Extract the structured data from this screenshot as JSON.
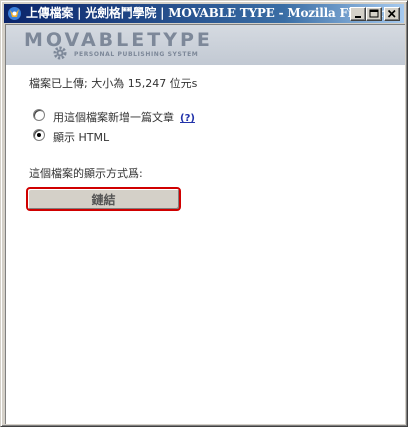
{
  "window": {
    "title": "上傳檔案 | 光劍格鬥學院 | MOVABLE TYPE - Mozilla Firebird",
    "controls": [
      "minimize",
      "maximize",
      "close"
    ]
  },
  "banner": {
    "logo": "MOVABLETYPE",
    "tagline": "PERSONAL PUBLISHING SYSTEM"
  },
  "main": {
    "status_text": "檔案已上傳; 大小為 15,247 位元s",
    "options": [
      {
        "label": "用這個檔案新增一篇文章",
        "help": "(?)",
        "checked": false
      },
      {
        "label": "顯示 HTML",
        "checked": true
      }
    ],
    "display_prompt": "這個檔案的顯示方式爲:",
    "link_button": "鏈結"
  },
  "colors": {
    "title_bar": "#0a246a",
    "highlight_border": "#d00000",
    "link": "#2233aa"
  }
}
